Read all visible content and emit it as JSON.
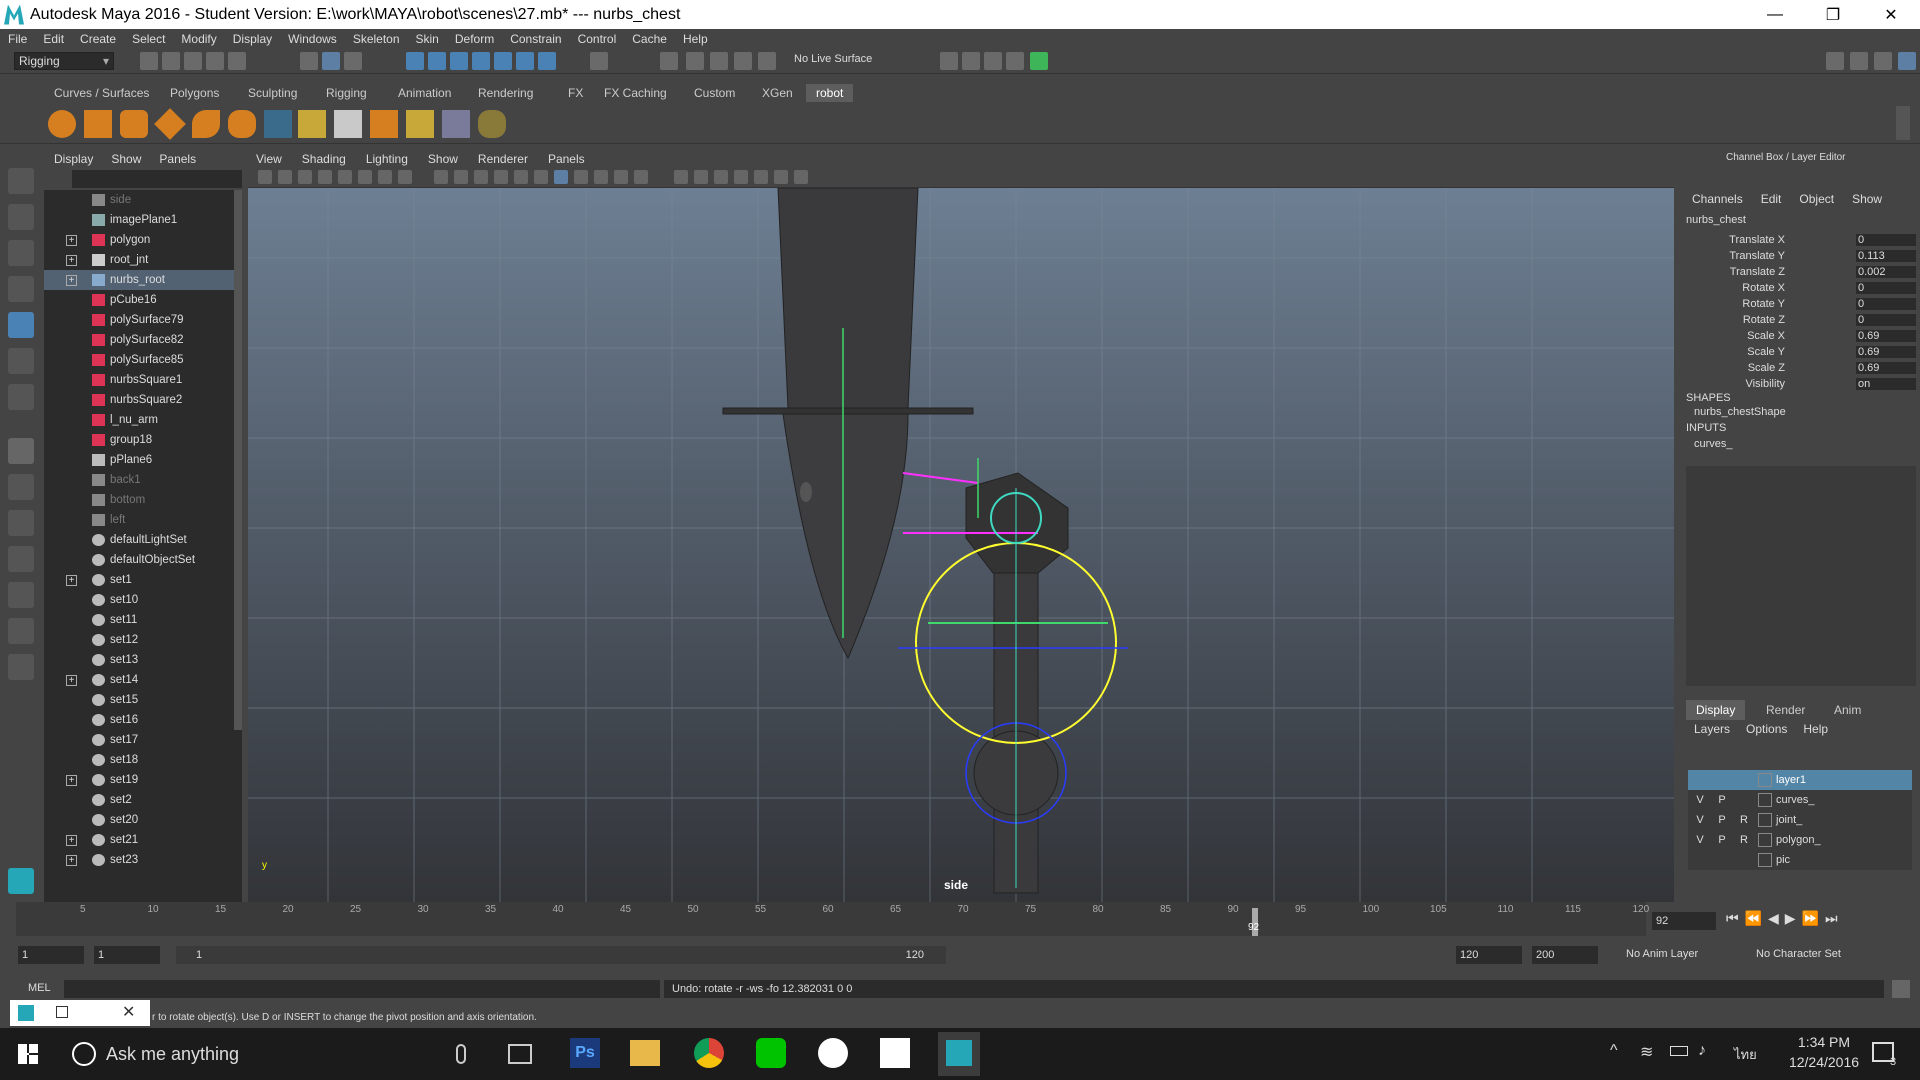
{
  "window": {
    "title": "Autodesk Maya 2016 - Student Version: E:\\work\\MAYA\\robot\\scenes\\27.mb*  ---  nurbs_chest",
    "minimize": "—",
    "maximize": "❐",
    "close": "✕"
  },
  "menubar": [
    "File",
    "Edit",
    "Create",
    "Select",
    "Modify",
    "Display",
    "Windows",
    "Skeleton",
    "Skin",
    "Deform",
    "Constrain",
    "Control",
    "Cache",
    "Help"
  ],
  "statusline": {
    "mode": "Rigging",
    "live_surface": "No Live Surface"
  },
  "shelf_tabs": [
    "Curves / Surfaces",
    "Polygons",
    "Sculpting",
    "Rigging",
    "Animation",
    "Rendering",
    "FX",
    "FX Caching",
    "Custom",
    "XGen",
    "robot"
  ],
  "shelf_active_tab": "robot",
  "outliner": {
    "menu": [
      "Display",
      "Show",
      "Panels"
    ],
    "items": [
      {
        "label": "side",
        "dim": true,
        "expand": false,
        "icon": "camera"
      },
      {
        "label": "imagePlane1",
        "dim": false,
        "expand": false,
        "icon": "image"
      },
      {
        "label": "polygon",
        "dim": false,
        "expand": true,
        "icon": "mesh"
      },
      {
        "label": "root_jnt",
        "dim": false,
        "expand": true,
        "icon": "joint"
      },
      {
        "label": "nurbs_root",
        "dim": false,
        "expand": true,
        "icon": "curve",
        "selected": true
      },
      {
        "label": "pCube16",
        "dim": false,
        "expand": false,
        "icon": "mesh"
      },
      {
        "label": "polySurface79",
        "dim": false,
        "expand": false,
        "icon": "mesh"
      },
      {
        "label": "polySurface82",
        "dim": false,
        "expand": false,
        "icon": "mesh"
      },
      {
        "label": "polySurface85",
        "dim": false,
        "expand": false,
        "icon": "mesh"
      },
      {
        "label": "nurbsSquare1",
        "dim": false,
        "expand": false,
        "icon": "mesh"
      },
      {
        "label": "nurbsSquare2",
        "dim": false,
        "expand": false,
        "icon": "mesh"
      },
      {
        "label": "l_nu_arm",
        "dim": false,
        "expand": false,
        "icon": "mesh"
      },
      {
        "label": "group18",
        "dim": false,
        "expand": false,
        "icon": "mesh"
      },
      {
        "label": "pPlane6",
        "dim": false,
        "expand": false,
        "icon": "group"
      },
      {
        "label": "back1",
        "dim": true,
        "expand": false,
        "icon": "camera"
      },
      {
        "label": "bottom",
        "dim": true,
        "expand": false,
        "icon": "camera"
      },
      {
        "label": "left",
        "dim": true,
        "expand": false,
        "icon": "camera"
      },
      {
        "label": "defaultLightSet",
        "dim": false,
        "expand": false,
        "icon": "set"
      },
      {
        "label": "defaultObjectSet",
        "dim": false,
        "expand": false,
        "icon": "set"
      },
      {
        "label": "set1",
        "dim": false,
        "expand": true,
        "icon": "set"
      },
      {
        "label": "set10",
        "dim": false,
        "expand": false,
        "icon": "set"
      },
      {
        "label": "set11",
        "dim": false,
        "expand": false,
        "icon": "set"
      },
      {
        "label": "set12",
        "dim": false,
        "expand": false,
        "icon": "set"
      },
      {
        "label": "set13",
        "dim": false,
        "expand": false,
        "icon": "set"
      },
      {
        "label": "set14",
        "dim": false,
        "expand": true,
        "icon": "set"
      },
      {
        "label": "set15",
        "dim": false,
        "expand": false,
        "icon": "set"
      },
      {
        "label": "set16",
        "dim": false,
        "expand": false,
        "icon": "set"
      },
      {
        "label": "set17",
        "dim": false,
        "expand": false,
        "icon": "set"
      },
      {
        "label": "set18",
        "dim": false,
        "expand": false,
        "icon": "set"
      },
      {
        "label": "set19",
        "dim": false,
        "expand": true,
        "icon": "set"
      },
      {
        "label": "set2",
        "dim": false,
        "expand": false,
        "icon": "set"
      },
      {
        "label": "set20",
        "dim": false,
        "expand": false,
        "icon": "set"
      },
      {
        "label": "set21",
        "dim": false,
        "expand": true,
        "icon": "set"
      },
      {
        "label": "set23",
        "dim": false,
        "expand": true,
        "icon": "set"
      }
    ]
  },
  "viewport": {
    "menu": [
      "View",
      "Shading",
      "Lighting",
      "Show",
      "Renderer",
      "Panels"
    ],
    "camera_label": "side",
    "axis_label": "y"
  },
  "channelbox": {
    "title": "Channel Box / Layer Editor",
    "menu": [
      "Channels",
      "Edit",
      "Object",
      "Show"
    ],
    "object": "nurbs_chest",
    "attributes": [
      {
        "name": "Translate X",
        "value": "0"
      },
      {
        "name": "Translate Y",
        "value": "0.113"
      },
      {
        "name": "Translate Z",
        "value": "0.002"
      },
      {
        "name": "Rotate X",
        "value": "0"
      },
      {
        "name": "Rotate Y",
        "value": "0"
      },
      {
        "name": "Rotate Z",
        "value": "0"
      },
      {
        "name": "Scale X",
        "value": "0.69"
      },
      {
        "name": "Scale Y",
        "value": "0.69"
      },
      {
        "name": "Scale Z",
        "value": "0.69"
      },
      {
        "name": "Visibility",
        "value": "on"
      }
    ],
    "shapes_header": "SHAPES",
    "shape": "nurbs_chestShape",
    "inputs_header": "INPUTS",
    "input": "curves_"
  },
  "layer_editor": {
    "tabs": [
      "Display",
      "Render",
      "Anim"
    ],
    "active_tab": "Display",
    "menu": [
      "Layers",
      "Options",
      "Help"
    ],
    "layers": [
      {
        "v": "",
        "p": "",
        "r": "",
        "name": "layer1",
        "active": true
      },
      {
        "v": "V",
        "p": "P",
        "r": "",
        "name": "curves_",
        "active": false
      },
      {
        "v": "V",
        "p": "P",
        "r": "R",
        "name": "joint_",
        "active": false
      },
      {
        "v": "V",
        "p": "P",
        "r": "R",
        "name": "polygon_",
        "active": false
      },
      {
        "v": "",
        "p": "",
        "r": "",
        "name": "pic",
        "active": false
      }
    ]
  },
  "timeline": {
    "ticks": [
      "5",
      "10",
      "15",
      "20",
      "25",
      "30",
      "35",
      "40",
      "45",
      "50",
      "55",
      "60",
      "65",
      "70",
      "75",
      "80",
      "85",
      "90",
      "95",
      "100",
      "105",
      "110",
      "115",
      "120"
    ],
    "current_frame": "92",
    "current_frame_field": "92",
    "range_start": "1",
    "range_start2": "1",
    "slider_start": "1",
    "slider_end": "120",
    "end_field": "120",
    "end_field2": "200",
    "anim_layer": "No Anim Layer",
    "character_set": "No Character Set"
  },
  "commandline": {
    "lang": "MEL",
    "result": "Undo: rotate -r -ws -fo 12.382031 0 0"
  },
  "helpline": {
    "text": "r to rotate object(s). Use D or INSERT to change the pivot position and axis orientation."
  },
  "taskbar": {
    "search": "Ask me anything",
    "time": "1:34 PM",
    "date": "12/24/2016",
    "lang": "ไทย",
    "notifications": "3"
  },
  "colors": {
    "accent": "#526273",
    "layer_active": "#5285a6",
    "maya_logo": "#25a7b7"
  }
}
